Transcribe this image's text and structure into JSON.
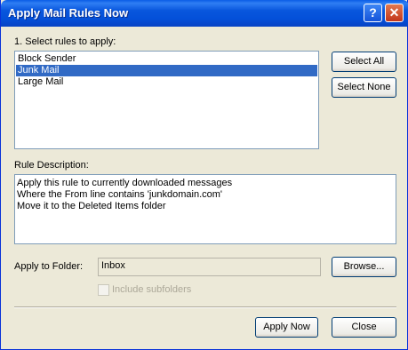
{
  "window": {
    "title": "Apply Mail Rules Now",
    "help_glyph": "?",
    "close_glyph": "✕"
  },
  "rules": {
    "label": "1. Select rules to apply:",
    "items": [
      {
        "label": "Block Sender",
        "selected": false
      },
      {
        "label": "Junk Mail",
        "selected": true
      },
      {
        "label": "Large Mail",
        "selected": false
      }
    ],
    "select_all": "Select All",
    "select_none": "Select None"
  },
  "description": {
    "label": "Rule Description:",
    "lines": [
      "Apply this rule to currently downloaded messages",
      "Where the From line contains 'junkdomain.com'",
      "Move it to the Deleted Items folder"
    ]
  },
  "folder": {
    "label": "Apply to Folder:",
    "value": "Inbox",
    "browse": "Browse..."
  },
  "subfolders": {
    "label": "Include subfolders",
    "checked": false
  },
  "footer": {
    "apply_now": "Apply Now",
    "close": "Close"
  },
  "colors": {
    "title_bar": "#0856dd",
    "selection": "#316ac5",
    "dialog_bg": "#ece9d8"
  }
}
